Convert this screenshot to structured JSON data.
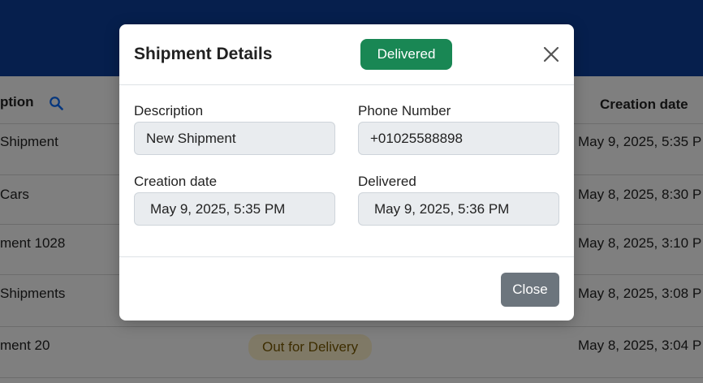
{
  "background_table": {
    "header": {
      "description": "ption",
      "creation_date": "Creation date"
    },
    "rows": [
      {
        "description": "Shipment",
        "date": "May 9, 2025, 5:35 P"
      },
      {
        "description": "Cars",
        "date": "May 8, 2025, 8:30 P"
      },
      {
        "description": "ment 1028",
        "date": "May 8, 2025, 3:10 P"
      },
      {
        "description": "Shipments",
        "date": "May 8, 2025, 3:08 P"
      },
      {
        "description": "ment 20",
        "date": "May 8, 2025, 3:04 P",
        "status": "Out for Delivery"
      }
    ]
  },
  "modal": {
    "title": "Shipment Details",
    "status_badge": "Delivered",
    "fields": {
      "description_label": "Description",
      "description_value": "New Shipment",
      "phone_label": "Phone Number",
      "phone_value": "+01025588898",
      "creation_label": "Creation date",
      "creation_value": "May 9, 2025, 5:35 PM",
      "delivered_label": "Delivered",
      "delivered_value": "May 9, 2025, 5:36 PM"
    },
    "close_button": "Close"
  },
  "colors": {
    "topbar": "#0d3f9a",
    "badge_delivered": "#198754",
    "close_button": "#6c757d",
    "search_icon": "#0d6efd"
  },
  "icons": {
    "search": "search-icon",
    "close": "close-icon"
  }
}
